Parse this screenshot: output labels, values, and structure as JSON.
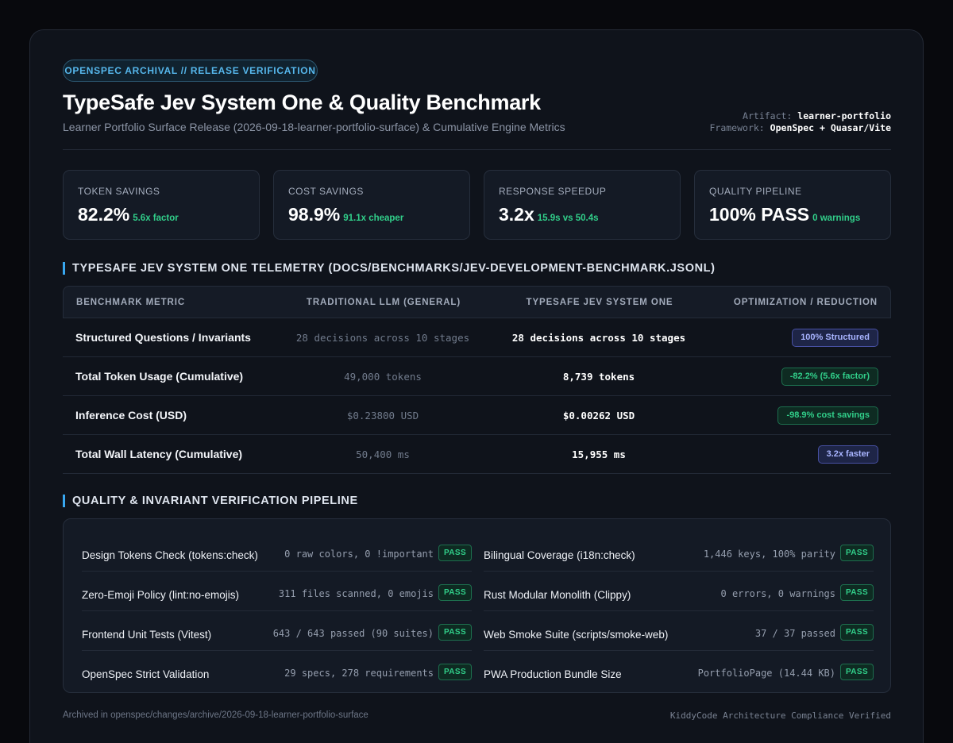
{
  "header": {
    "badge": "OPENSPEC ARCHIVAL // RELEASE VERIFICATION",
    "title": "TypeSafe Jev System One & Quality Benchmark",
    "subtitle": "Learner Portfolio Surface Release (2026-09-18-learner-portfolio-surface) & Cumulative Engine Metrics",
    "artifact_label": "Artifact:",
    "artifact_value": "learner-portfolio",
    "framework_label": "Framework:",
    "framework_value": "OpenSpec + Quasar/Vite"
  },
  "kpis": [
    {
      "label": "TOKEN SAVINGS",
      "value": "82.2%",
      "note": "5.6x factor"
    },
    {
      "label": "COST SAVINGS",
      "value": "98.9%",
      "note": "91.1x cheaper"
    },
    {
      "label": "RESPONSE SPEEDUP",
      "value": "3.2x",
      "note": "15.9s vs 50.4s"
    },
    {
      "label": "QUALITY PIPELINE",
      "value": "100% PASS",
      "note": "0 warnings"
    }
  ],
  "telemetry": {
    "title": "TYPESAFE JEV SYSTEM ONE TELEMETRY (DOCS/BENCHMARKS/JEV-DEVELOPMENT-BENCHMARK.JSONL)",
    "columns": [
      "BENCHMARK METRIC",
      "TRADITIONAL LLM (GENERAL)",
      "TYPESAFE JEV SYSTEM ONE",
      "OPTIMIZATION / REDUCTION"
    ],
    "rows": [
      {
        "metric": "Structured Questions / Invariants",
        "traditional": "28 decisions across 10 stages",
        "jev": "28 decisions across 10 stages",
        "result": "100% Structured",
        "tone": "blue"
      },
      {
        "metric": "Total Token Usage (Cumulative)",
        "traditional": "49,000 tokens",
        "jev": "8,739 tokens",
        "result": "-82.2% (5.6x factor)",
        "tone": "green"
      },
      {
        "metric": "Inference Cost (USD)",
        "traditional": "$0.23800 USD",
        "jev": "$0.00262 USD",
        "result": "-98.9% cost savings",
        "tone": "green"
      },
      {
        "metric": "Total Wall Latency (Cumulative)",
        "traditional": "50,400 ms",
        "jev": "15,955 ms",
        "result": "3.2x faster",
        "tone": "blue"
      }
    ]
  },
  "quality": {
    "title": "QUALITY & INVARIANT VERIFICATION PIPELINE",
    "pass_label": "PASS",
    "checks": [
      {
        "label": "Design Tokens Check (tokens:check)",
        "stat": "0 raw colors, 0 !important"
      },
      {
        "label": "Bilingual Coverage (i18n:check)",
        "stat": "1,446 keys, 100% parity"
      },
      {
        "label": "Zero-Emoji Policy (lint:no-emojis)",
        "stat": "311 files scanned, 0 emojis"
      },
      {
        "label": "Rust Modular Monolith (Clippy)",
        "stat": "0 errors, 0 warnings"
      },
      {
        "label": "Frontend Unit Tests (Vitest)",
        "stat": "643 / 643 passed (90 suites)"
      },
      {
        "label": "Web Smoke Suite (scripts/smoke-web)",
        "stat": "37 / 37 passed"
      },
      {
        "label": "OpenSpec Strict Validation",
        "stat": "29 specs, 278 requirements"
      },
      {
        "label": "PWA Production Bundle Size",
        "stat": "PortfolioPage (14.44 KB)"
      }
    ]
  },
  "footer": {
    "left": "Archived in openspec/changes/archive/2026-09-18-learner-portfolio-surface",
    "right": "KiddyCode Architecture Compliance Verified"
  }
}
